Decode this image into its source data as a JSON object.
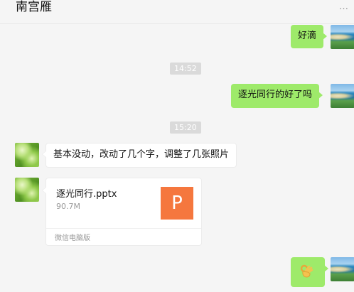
{
  "header": {
    "title": "南宫雁",
    "more_icon": "ellipsis-icon"
  },
  "messages": [
    {
      "from": "me",
      "text": "好滴"
    },
    {
      "from": "system",
      "time": "14:52"
    },
    {
      "from": "me",
      "text": "逐光同行的好了吗"
    },
    {
      "from": "system",
      "time": "15:20"
    },
    {
      "from": "other",
      "text": "基本没动，改动了几个字，调整了几张照片"
    },
    {
      "from": "other",
      "file": {
        "name": "逐光同行.pptx",
        "size": "90.7M",
        "icon_letter": "P",
        "source": "微信电脑版"
      }
    },
    {
      "from": "me",
      "emoji": "ok-hand-icon"
    }
  ],
  "colors": {
    "my_bubble": "#9eea6a",
    "file_icon": "#f5773e"
  }
}
